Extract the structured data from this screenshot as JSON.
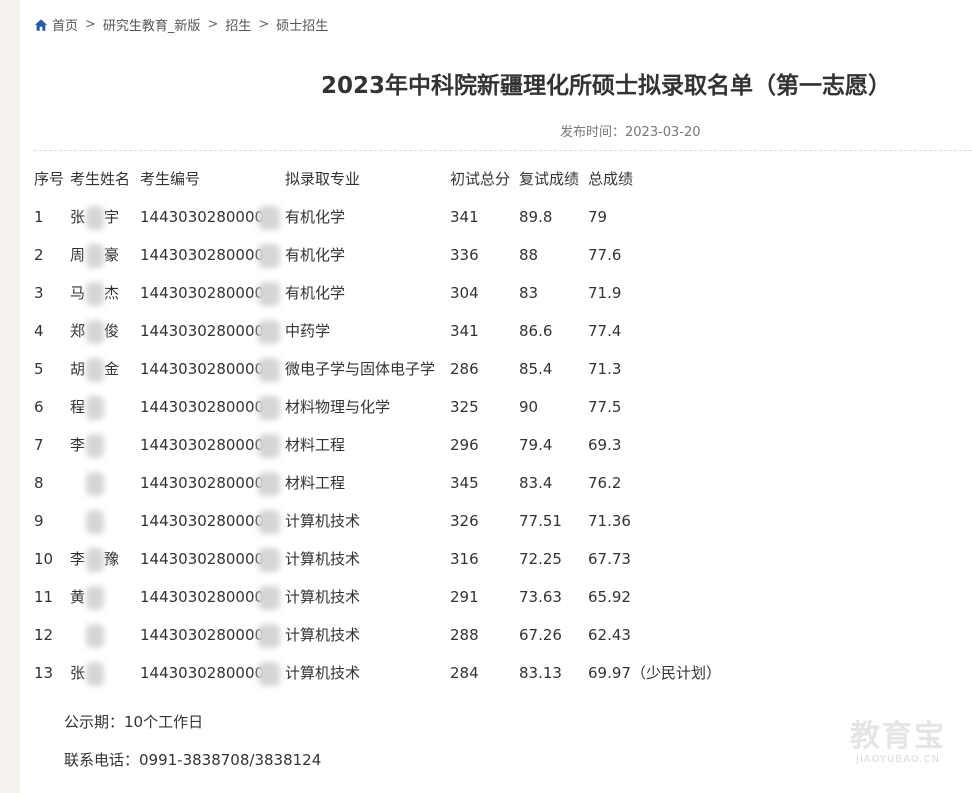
{
  "breadcrumb": {
    "home_label": "首页",
    "items": [
      "研究生教育_新版",
      "招生",
      "硕士招生"
    ]
  },
  "article": {
    "title": "2023年中科院新疆理化所硕士拟录取名单（第一志愿）",
    "date_label": "发布时间：",
    "date": "2023-03-20"
  },
  "table": {
    "headers": [
      "序号",
      "考生姓名",
      "考生编号",
      "拟录取专业",
      "初试总分",
      "复试成绩",
      "总成绩"
    ],
    "rows": [
      {
        "no": "1",
        "name": "张",
        "name_tail": "宇",
        "id": "1443030280000",
        "major": "有机化学",
        "initial": "341",
        "retest": "89.8",
        "total": "79"
      },
      {
        "no": "2",
        "name": "周",
        "name_tail": "豪",
        "id": "1443030280000",
        "major": "有机化学",
        "initial": "336",
        "retest": "88",
        "total": "77.6"
      },
      {
        "no": "3",
        "name": "马",
        "name_tail": "杰",
        "id": "1443030280000",
        "major": "有机化学",
        "initial": "304",
        "retest": "83",
        "total": "71.9"
      },
      {
        "no": "4",
        "name": "郑",
        "name_tail": "俊",
        "id": "1443030280000",
        "major": "中药学",
        "initial": "341",
        "retest": "86.6",
        "total": "77.4"
      },
      {
        "no": "5",
        "name": "胡",
        "name_tail": "金",
        "id": "1443030280000",
        "major": "微电子学与固体电子学",
        "initial": "286",
        "retest": "85.4",
        "total": "71.3"
      },
      {
        "no": "6",
        "name": "程",
        "name_tail": "",
        "id": "1443030280000",
        "major": "材料物理与化学",
        "initial": "325",
        "retest": "90",
        "total": "77.5"
      },
      {
        "no": "7",
        "name": "李",
        "name_tail": "",
        "id": "1443030280000",
        "major": "材料工程",
        "initial": "296",
        "retest": "79.4",
        "total": "69.3"
      },
      {
        "no": "8",
        "name": "",
        "name_tail": "",
        "id": "1443030280000",
        "major": "材料工程",
        "initial": "345",
        "retest": "83.4",
        "total": "76.2"
      },
      {
        "no": "9",
        "name": "",
        "name_tail": "",
        "id": "1443030280000",
        "major": "计算机技术",
        "initial": "326",
        "retest": "77.51",
        "total": "71.36"
      },
      {
        "no": "10",
        "name": "李",
        "name_tail": "豫",
        "id": "1443030280000",
        "major": "计算机技术",
        "initial": "316",
        "retest": "72.25",
        "total": "67.73"
      },
      {
        "no": "11",
        "name": "黄",
        "name_tail": "",
        "id": "1443030280000",
        "major": "计算机技术",
        "initial": "291",
        "retest": "73.63",
        "total": "65.92"
      },
      {
        "no": "12",
        "name": "",
        "name_tail": "",
        "id": "1443030280000",
        "major": "计算机技术",
        "initial": "288",
        "retest": "67.26",
        "total": "62.43"
      },
      {
        "no": "13",
        "name": "张",
        "name_tail": "",
        "id": "1443030280000",
        "major": "计算机技术",
        "initial": "284",
        "retest": "83.13",
        "total": "69.97（少民计划）"
      }
    ]
  },
  "footer": {
    "notice_period": "公示期：10个工作日",
    "phone": "联系电话：0991-3838708/3838124"
  },
  "watermark": {
    "big": "教育宝",
    "small": "JIAOYUBAO.CN"
  },
  "colors": {
    "left_strip": "#f6f3ef",
    "home_icon": "#2b5aa8"
  },
  "icons": {
    "home": "home-icon"
  }
}
